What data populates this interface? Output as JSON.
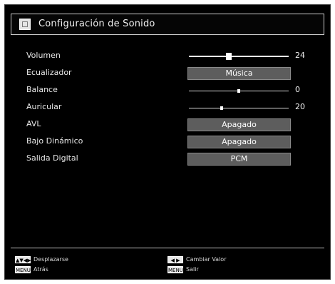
{
  "header": {
    "title": "Configuración de Sonido"
  },
  "menu": {
    "volumen": {
      "label": "Volumen",
      "value": "24",
      "level": 0.4
    },
    "ecualizador": {
      "label": "Ecualizador",
      "value": "Música"
    },
    "balance": {
      "label": "Balance",
      "value": "0",
      "level": 0.5
    },
    "auricular": {
      "label": "Auricular",
      "value": "20",
      "level": 0.33
    },
    "avl": {
      "label": "AVL",
      "value": "Apagado"
    },
    "bajo": {
      "label": "Bajo Dinámico",
      "value": "Apagado"
    },
    "salida": {
      "label": "Salida Digital",
      "value": "PCM"
    }
  },
  "footer": {
    "move": {
      "key": "▲▼◀▶",
      "label": "Desplazarse"
    },
    "change": {
      "key": "◀ ▶",
      "label": "Cambiar Valor"
    },
    "back": {
      "key": "MENU",
      "label": "Atrás"
    },
    "exit": {
      "key": "MENU",
      "label": "Salir"
    }
  }
}
